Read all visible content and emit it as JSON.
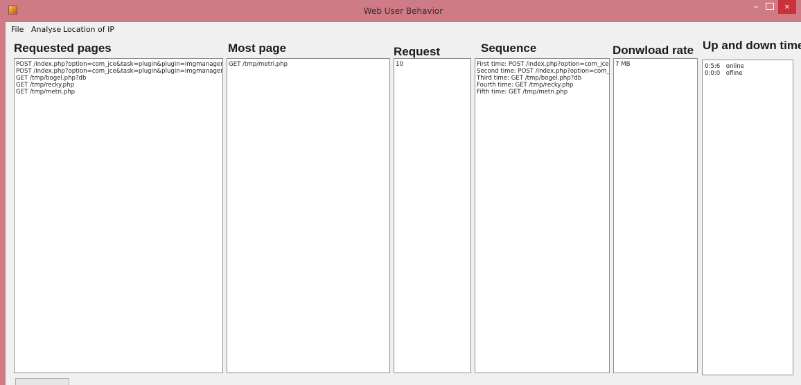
{
  "window": {
    "title": "Web User Behavior",
    "controls": {
      "minimize": "–",
      "close": "×"
    }
  },
  "menu": [
    "File",
    "Analyse",
    "Location of IP"
  ],
  "headers": {
    "requested_pages": "Requested pages",
    "most_page": "Most page",
    "request": "Request",
    "sequence": "Sequence",
    "download_rate": "Donwload rate",
    "up_down_time": "Up and down time"
  },
  "requested_pages": [
    "POST /index.php?option=com_jce&task=plugin&plugin=imgmanager&file=",
    "POST /index.php?option=com_jce&task=plugin&plugin=imgmanager&file=",
    "GET /tmp/bogel.php?db",
    "GET /tmp/recky.php",
    "GET /tmp/metri.php"
  ],
  "most_page": "GET /tmp/metri.php",
  "request_count": "10",
  "sequence": [
    "First time: POST /index.php?option=com_jce&t",
    "Second time: POST /index.php?option=com_jc",
    "Third time: GET /tmp/bogel.php?db",
    "Fourth time: GET /tmp/recky.php",
    "Fifth time: GET /tmp/metri.php"
  ],
  "download_rate": "7 MB",
  "up_down_time": [
    {
      "time": "0:5:6",
      "status": "online"
    },
    {
      "time": "0:0:0",
      "status": "ofline"
    }
  ]
}
